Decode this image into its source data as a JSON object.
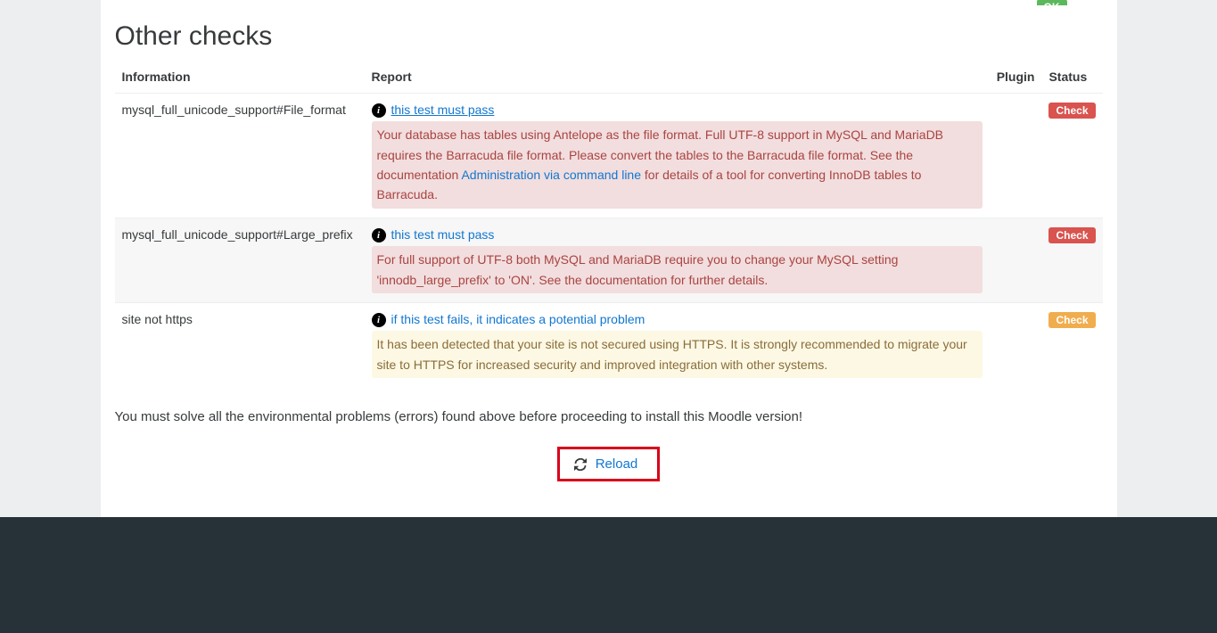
{
  "section_title": "Other checks",
  "headers": {
    "information": "Information",
    "report": "Report",
    "plugin": "Plugin",
    "status": "Status"
  },
  "badges": {
    "check": "Check",
    "ok": "OK"
  },
  "rows": [
    {
      "info": "mysql_full_unicode_support#File_format",
      "link_text": "this test must pass",
      "link_underline": true,
      "alert_class": "alert-error",
      "msg_pre": "Your database has tables using Antelope as the file format. Full UTF-8 support in MySQL and MariaDB requires the Barracuda file format. Please convert the tables to the Barracuda file format. See the documentation ",
      "inline_link": "Administration via command line",
      "msg_post": " for details of a tool for converting InnoDB tables to Barracuda.",
      "status_class": "badge-danger"
    },
    {
      "info": "mysql_full_unicode_support#Large_prefix",
      "link_text": "this test must pass",
      "link_underline": false,
      "alert_class": "alert-error",
      "msg_pre": "For full support of UTF-8 both MySQL and MariaDB require you to change your MySQL setting 'innodb_large_prefix' to 'ON'. See the documentation for further details.",
      "inline_link": "",
      "msg_post": "",
      "status_class": "badge-danger"
    },
    {
      "info": "site not https",
      "link_text": "if this test fails, it indicates a potential problem",
      "link_underline": false,
      "alert_class": "alert-warn",
      "msg_pre": "It has been detected that your site is not secured using HTTPS. It is strongly recommended to migrate your site to HTTPS for increased security and improved integration with other systems.",
      "inline_link": "",
      "msg_post": "",
      "status_class": "badge-warning"
    }
  ],
  "instruction": "You must solve all the environmental problems (errors) found above before proceeding to install this Moodle version!",
  "reload_label": "Reload"
}
